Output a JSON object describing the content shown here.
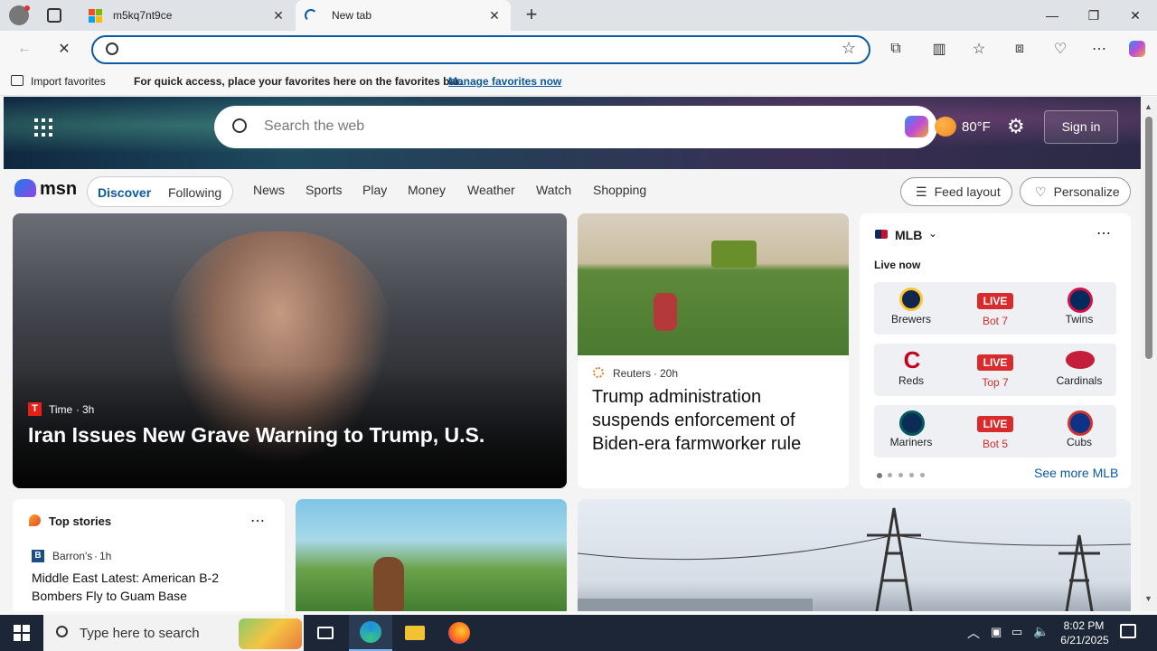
{
  "browser": {
    "tabs": [
      {
        "title": "m5kq7nt9ce",
        "active": false
      },
      {
        "title": "New tab",
        "active": true
      }
    ],
    "address_value": "",
    "favorites_bar": {
      "import_label": "Import favorites",
      "message": "For quick access, place your favorites here on the favorites bar.",
      "manage_link": "Manage favorites now"
    }
  },
  "msn": {
    "search_placeholder": "Search the web",
    "temperature": "80°F",
    "sign_in": "Sign in",
    "brand": "msn",
    "nav": {
      "discover": "Discover",
      "following": "Following",
      "links": [
        "News",
        "Sports",
        "Play",
        "Money",
        "Weather",
        "Watch",
        "Shopping"
      ],
      "feed_layout": "Feed layout",
      "personalize": "Personalize"
    },
    "hero_story": {
      "source": "Time",
      "age": "3h",
      "headline": "Iran Issues New Grave Warning to Trump, U.S."
    },
    "side_story": {
      "source": "Reuters",
      "age": "20h",
      "headline": "Trump administration suspends enforcement of Biden-era farmworker rule"
    },
    "mlb": {
      "title": "MLB",
      "live_now": "Live now",
      "see_more": "See more MLB",
      "games": [
        {
          "home": "Brewers",
          "away": "Twins",
          "status": "LIVE",
          "inning": "Bot 7"
        },
        {
          "home": "Reds",
          "away": "Cardinals",
          "status": "LIVE",
          "inning": "Top 7"
        },
        {
          "home": "Mariners",
          "away": "Cubs",
          "status": "LIVE",
          "inning": "Bot 5"
        }
      ]
    },
    "top_stories": {
      "title": "Top stories",
      "source": "Barron's",
      "age": "1h",
      "headline": "Middle East Latest: American B-2 Bombers Fly to Guam Base"
    }
  },
  "taskbar": {
    "search_placeholder": "Type here to search",
    "time": "8:02 PM",
    "date": "6/21/2025"
  },
  "colors": {
    "accent": "#0c59a4",
    "live_red": "#d92b2b",
    "taskbar": "#1c2636"
  }
}
